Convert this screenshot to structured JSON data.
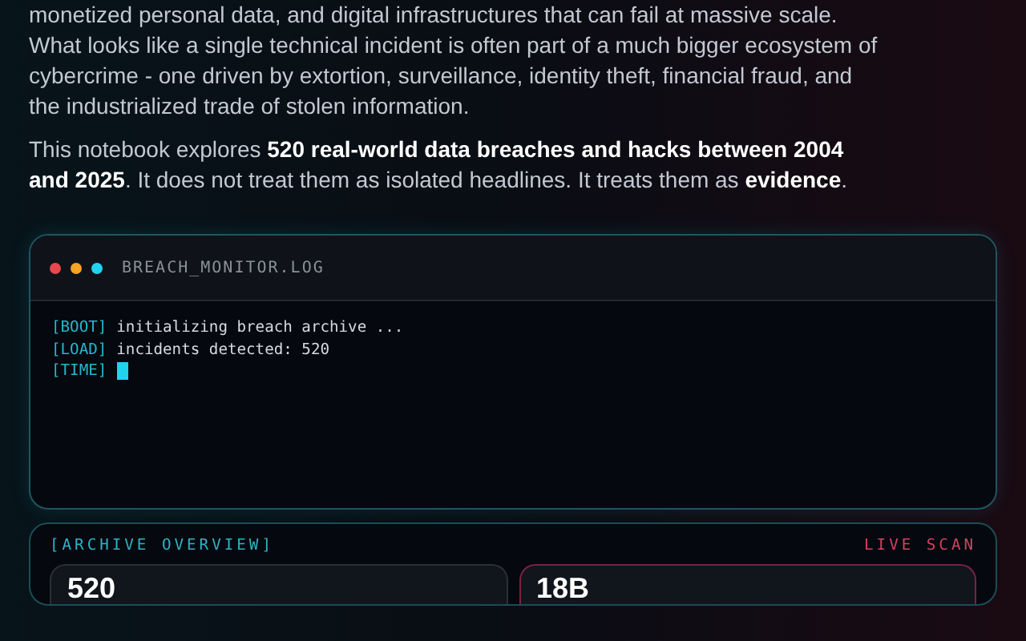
{
  "intro": {
    "paragraphs": [
      "monetized personal data, and digital infrastructures that can fail at massive scale. What looks like a single technical incident is often part of a much bigger ecosystem of cybercrime - one driven by extortion, surveillance, identity theft, financial fraud, and the industrialized trade of stolen information.",
      "This notebook explores **520 real-world data breaches and hacks between 2004 and 2025**. It does not treat them as isolated headlines. It treats them as **evidence**."
    ]
  },
  "terminal": {
    "title": "BREACH_MONITOR.LOG",
    "lines": [
      {
        "tag": "[BOOT]",
        "text": "initializing breach archive ...",
        "cursor": false
      },
      {
        "tag": "[LOAD]",
        "text": "incidents detected: 520",
        "cursor": false
      },
      {
        "tag": "[TIME]",
        "cursor": true
      }
    ]
  },
  "overview": {
    "title": "[ARCHIVE OVERVIEW]",
    "status": "LIVE SCAN",
    "cards": [
      {
        "value": "520",
        "alert": false
      },
      {
        "value": "18B",
        "alert": true
      }
    ]
  }
}
